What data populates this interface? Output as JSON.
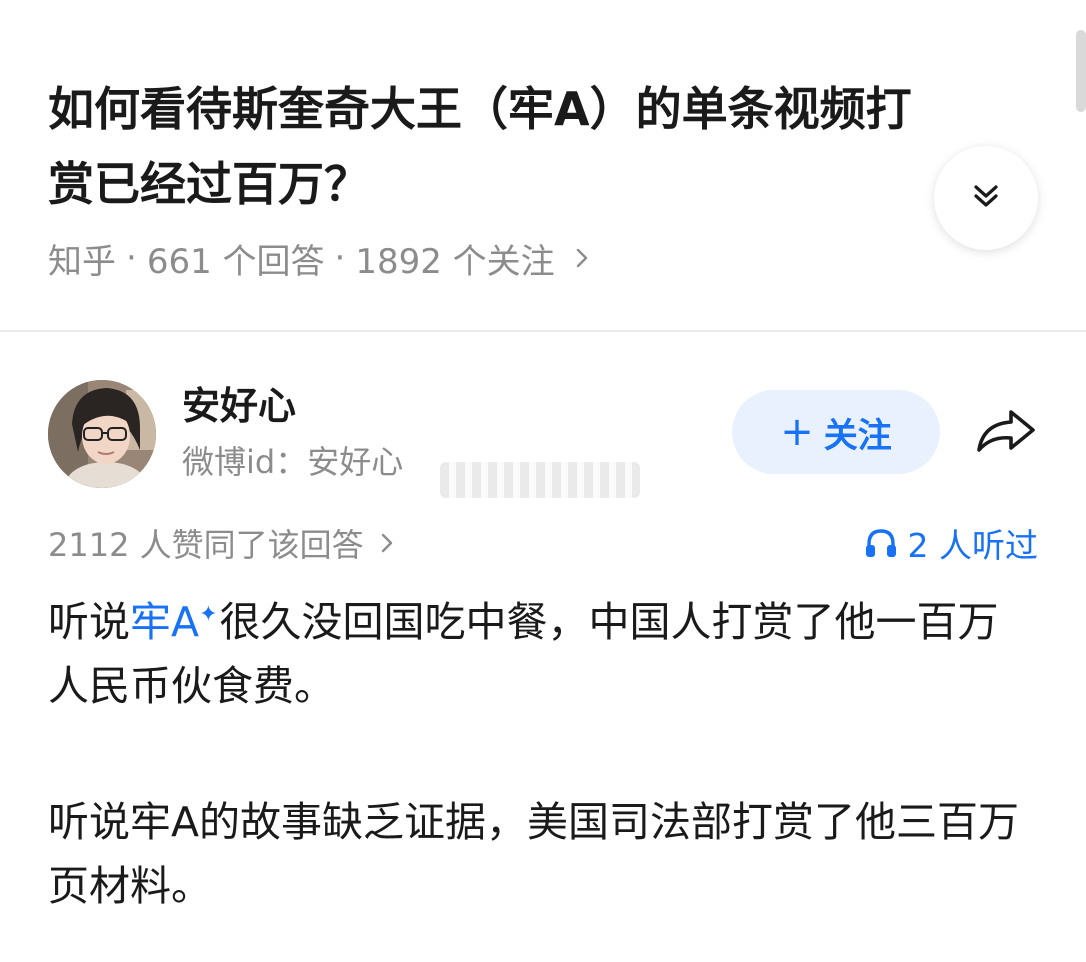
{
  "question": {
    "title": "如何看待斯奎奇大王（牢A）的单条视频打赏已经过百万？",
    "source": "知乎",
    "answers": "661 个回答",
    "followers": "1892 个关注",
    "separator": "·"
  },
  "answer": {
    "author_name": "安好心",
    "author_bio": "微博id：安好心",
    "follow_label": "关注",
    "follow_plus": "+",
    "votes": "2112 人赞同了该回答",
    "listened": "2 人听过",
    "paragraph1": {
      "before": "听说",
      "link": "牢A",
      "link_mark": "✦",
      "after": "很久没回国吃中餐，中国人打赏了他一百万人民币伙食费。"
    },
    "paragraph2": "听说牢A的故事缺乏证据，美国司法部打赏了他三百万页材料。"
  },
  "colors": {
    "accent": "#1772f6",
    "follow_bg": "#e8f1fd",
    "muted": "#8c8c8c",
    "text": "#1a1a1a"
  },
  "icons": [
    "chevron-double-down-icon",
    "chevron-right-icon",
    "share-icon",
    "headphones-icon"
  ]
}
